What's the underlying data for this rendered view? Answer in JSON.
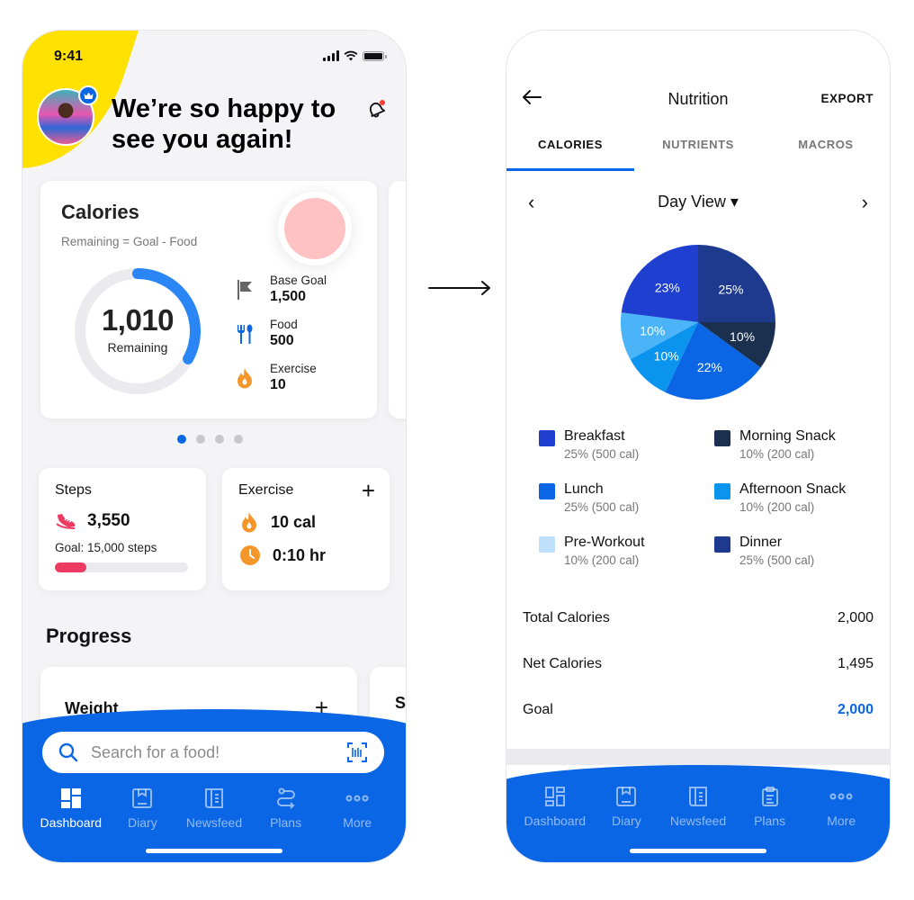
{
  "dashboard": {
    "status_time": "9:41",
    "greeting": "We’re so happy to see you again!",
    "calories_card": {
      "title": "Calories",
      "subtitle": "Remaining = Goal - Food",
      "remaining_value": "1,010",
      "remaining_label": "Remaining",
      "ring_progress_fraction": 0.33,
      "stats": [
        {
          "icon": "flag-icon",
          "label": "Base Goal",
          "value": "1,500"
        },
        {
          "icon": "fork-spoon-icon",
          "label": "Food",
          "value": "500"
        },
        {
          "icon": "flame-icon",
          "label": "Exercise",
          "value": "10"
        }
      ]
    },
    "carousel": {
      "pages": 4,
      "active_index": 0
    },
    "steps_card": {
      "title": "Steps",
      "value": "3,550",
      "goal": "Goal: 15,000 steps",
      "progress_fraction": 0.2367
    },
    "exercise_card": {
      "title": "Exercise",
      "add_label": "+",
      "calories": "10 cal",
      "duration": "0:10 hr"
    },
    "progress_section": {
      "title": "Progress",
      "weight_card": {
        "title": "Weight",
        "add_label": "+"
      },
      "peek_card_title": "S"
    },
    "search": {
      "placeholder": "Search for a food!"
    },
    "tabbar": [
      {
        "label": "Dashboard",
        "icon": "dashboard-icon",
        "active": true
      },
      {
        "label": "Diary",
        "icon": "diary-icon",
        "active": false
      },
      {
        "label": "Newsfeed",
        "icon": "newsfeed-icon",
        "active": false
      },
      {
        "label": "Plans",
        "icon": "plans-icon",
        "active": false
      },
      {
        "label": "More",
        "icon": "more-icon",
        "active": false
      }
    ]
  },
  "nutrition": {
    "title": "Nutrition",
    "export_label": "EXPORT",
    "tabs": [
      {
        "label": "CALORIES",
        "active": true
      },
      {
        "label": "NUTRIENTS",
        "active": false
      },
      {
        "label": "MACROS",
        "active": false
      }
    ],
    "period": {
      "prev": "‹",
      "next": "›",
      "selected": "Day View ▾"
    },
    "legend": [
      {
        "name": "Breakfast",
        "detail": "25% (500 cal)",
        "color": "#1e3fd0"
      },
      {
        "name": "Morning Snack",
        "detail": "10% (200 cal)",
        "color": "#1b2f4e"
      },
      {
        "name": "Lunch",
        "detail": "25% (500 cal)",
        "color": "#0a66e4"
      },
      {
        "name": "Afternoon Snack",
        "detail": "10% (200 cal)",
        "color": "#0a94ee"
      },
      {
        "name": "Pre-Workout",
        "detail": "10% (200 cal)",
        "color": "#bfe0fb"
      },
      {
        "name": "Dinner",
        "detail": "25% (500 cal)",
        "color": "#1e3a8f"
      }
    ],
    "summary": [
      {
        "label": "Total Calories",
        "value": "2,000",
        "highlight": false
      },
      {
        "label": "Net Calories",
        "value": "1,495",
        "highlight": false
      },
      {
        "label": "Goal",
        "value": "2,000",
        "highlight": true
      }
    ],
    "tabbar": [
      {
        "label": "Dashboard",
        "icon": "dashboard-icon",
        "active": false
      },
      {
        "label": "Diary",
        "icon": "diary-icon",
        "active": false
      },
      {
        "label": "Newsfeed",
        "icon": "newsfeed-icon",
        "active": false
      },
      {
        "label": "Plans",
        "icon": "plans-icon",
        "active": false
      },
      {
        "label": "More",
        "icon": "more-icon",
        "active": false
      }
    ]
  },
  "chart_data": {
    "type": "pie",
    "title": "",
    "start": "12 o'clock, clockwise",
    "slices": [
      {
        "label": "25%",
        "value": 25,
        "color": "#1e3a8f"
      },
      {
        "label": "10%",
        "value": 10,
        "color": "#1b2f4e"
      },
      {
        "label": "22%",
        "value": 22,
        "color": "#0a66e4"
      },
      {
        "label": "10%",
        "value": 10,
        "color": "#0a94ee"
      },
      {
        "label": "10%",
        "value": 10,
        "color": "#4bb4f8"
      },
      {
        "label": "23%",
        "value": 23,
        "color": "#1e3fd0"
      }
    ]
  },
  "colors": {
    "accent": "#0a66e4",
    "steps": "#ec3a62",
    "exercise": "#f5962b",
    "highlight_yellow": "#ffe100"
  }
}
